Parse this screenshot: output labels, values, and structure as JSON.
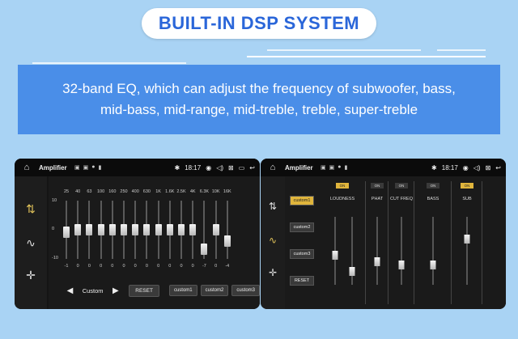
{
  "header": {
    "title": "BUILT-IN DSP SYSTEM"
  },
  "banner": {
    "line1": "32-band EQ, which can adjust the frequency of subwoofer, bass,",
    "line2": "mid-bass, mid-range, mid-treble, treble, super-treble"
  },
  "colors": {
    "accent": "#2a66d9",
    "banner": "#4a8ee8",
    "background": "#a9d3f4",
    "highlight": "#e0b53c"
  },
  "left_screen": {
    "status": {
      "title": "Amplifier",
      "time": "18:17"
    },
    "eq": {
      "scale": [
        "10",
        "0",
        "-10"
      ],
      "bands": [
        {
          "freq": "25",
          "value": "-1"
        },
        {
          "freq": "40",
          "value": "0"
        },
        {
          "freq": "63",
          "value": "0"
        },
        {
          "freq": "100",
          "value": "0"
        },
        {
          "freq": "160",
          "value": "0"
        },
        {
          "freq": "250",
          "value": "0"
        },
        {
          "freq": "400",
          "value": "0"
        },
        {
          "freq": "630",
          "value": "0"
        },
        {
          "freq": "1K",
          "value": "0"
        },
        {
          "freq": "1.6K",
          "value": "0"
        },
        {
          "freq": "2.5K",
          "value": "0"
        },
        {
          "freq": "4K",
          "value": "0"
        },
        {
          "freq": "6.3K",
          "value": "-7"
        },
        {
          "freq": "10K",
          "value": "0"
        },
        {
          "freq": "16K",
          "value": "-4"
        }
      ]
    },
    "preset": {
      "prev": "◀",
      "name": "Custom",
      "next": "▶"
    },
    "buttons": {
      "reset": "RESET",
      "custom1": "custom1",
      "custom2": "custom2",
      "custom3": "custom3"
    }
  },
  "right_screen": {
    "status": {
      "title": "Amplifier",
      "time": "18:17"
    },
    "presets": [
      "custom1",
      "custom2",
      "custom3",
      "RESET"
    ],
    "columns": [
      {
        "label": "LOUDNESS",
        "button": "ON"
      },
      {
        "label": "PHAT",
        "button": "ON"
      },
      {
        "label": "CUT FREQ",
        "button": "ON"
      },
      {
        "label": "BASS",
        "button": "ON"
      },
      {
        "label": "SUB",
        "button": "ON"
      }
    ]
  }
}
